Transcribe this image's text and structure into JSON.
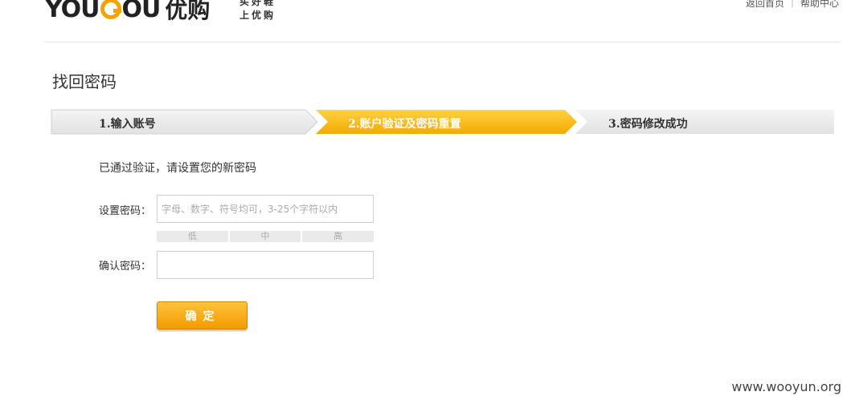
{
  "header": {
    "logo_text": "YOU",
    "logo_text_tail": "OU",
    "logo_cn": "优购",
    "slogan_line1": "买好鞋",
    "slogan_line2": "上优购",
    "links": [
      "返回首页",
      "帮助中心"
    ]
  },
  "page_title": "找回密码",
  "steps": [
    {
      "label": "1.输入账号",
      "state": "done"
    },
    {
      "label": "2.账户验证及密码重置",
      "state": "active"
    },
    {
      "label": "3.密码修改成功",
      "state": "pending"
    }
  ],
  "colors": {
    "accent": "#f7b500",
    "step_gray": "#e9e9e9"
  },
  "form": {
    "note": "已通过验证，请设置您的新密码",
    "password_label": "设置密码：",
    "password_placeholder": "字母、数字、符号均可，3-25个字符以内",
    "password_value": "",
    "strength_levels": [
      "低",
      "中",
      "高"
    ],
    "confirm_label": "确认密码：",
    "confirm_value": "",
    "submit_label": "确定"
  },
  "watermark": "www.wooyun.org"
}
